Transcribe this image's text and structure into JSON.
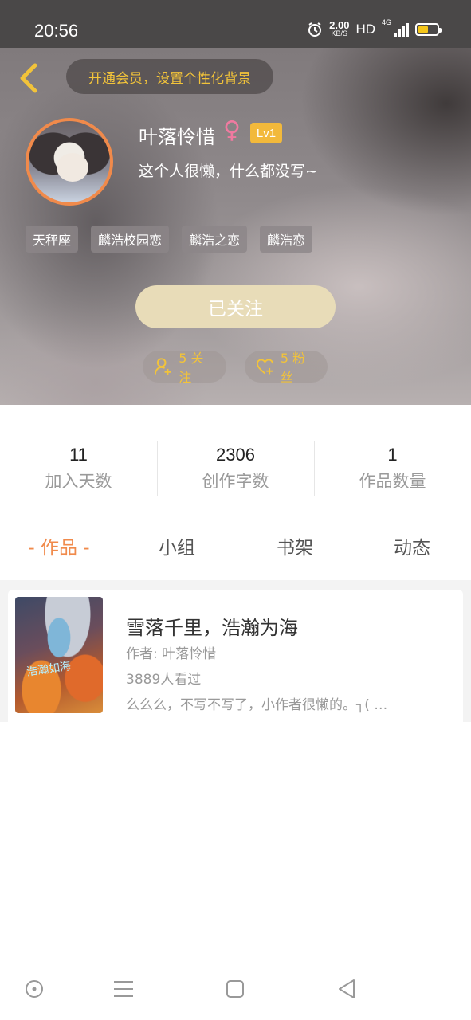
{
  "status_bar": {
    "time": "20:56",
    "net_speed_value": "2.00",
    "net_speed_unit": "KB/S",
    "hd": "HD",
    "network": "4G",
    "battery_color": "#f4c61a"
  },
  "header": {
    "back_icon": "chevron-left-icon",
    "vip_text": "开通会员，设置个性化背景",
    "username": "叶落怜惜",
    "gender_symbol": "♀",
    "level": "Lv1",
    "signature": "这个人很懒，什么都没写~",
    "tags": [
      "天秤座",
      "麟浩校园恋",
      "麟浩之恋",
      "麟浩恋"
    ],
    "follow_button": "已关注",
    "following": "5 关注",
    "fans": "5 粉丝",
    "accent_color": "#f2c33a"
  },
  "stats": [
    {
      "value": "11",
      "label": "加入天数"
    },
    {
      "value": "2306",
      "label": "创作字数"
    },
    {
      "value": "1",
      "label": "作品数量"
    }
  ],
  "tabs": [
    {
      "label": "- 作品 -",
      "active": true
    },
    {
      "label": "小组",
      "active": false
    },
    {
      "label": "书架",
      "active": false
    },
    {
      "label": "动态",
      "active": false
    }
  ],
  "works": [
    {
      "cover_text": "浩瀚如海",
      "title": "雪落千里，浩瀚为海",
      "author": "作者: 叶落怜惜",
      "views": "3889人看过",
      "description": "么么么，不写不写了，小作者很懒的。┐( …"
    }
  ],
  "navbar": {
    "icons": [
      "home-circle-icon",
      "menu-icon",
      "square-icon",
      "back-triangle-icon"
    ]
  },
  "colors": {
    "orange": "#f08a4b",
    "pink": "#f07aa0"
  }
}
